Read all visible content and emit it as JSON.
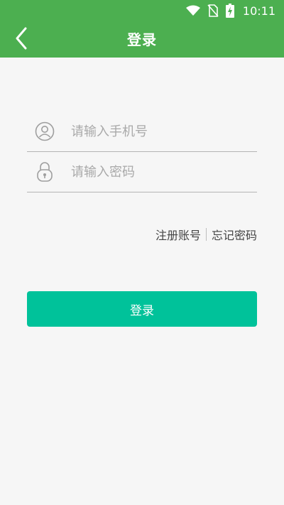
{
  "status_bar": {
    "time": "10:11",
    "icons": [
      "wifi-icon",
      "no-sim-icon",
      "battery-charging-icon"
    ]
  },
  "header": {
    "title": "登录",
    "back_icon": "chevron-left-icon",
    "background_color": "#4caf50"
  },
  "form": {
    "phone": {
      "value": "",
      "placeholder": "请输入手机号",
      "icon": "user-icon"
    },
    "password": {
      "value": "",
      "placeholder": "请输入密码",
      "icon": "lock-icon"
    }
  },
  "links": {
    "register": "注册账号",
    "forgot_password": "忘记密码"
  },
  "login_button": {
    "label": "登录",
    "color": "#00c29a"
  }
}
